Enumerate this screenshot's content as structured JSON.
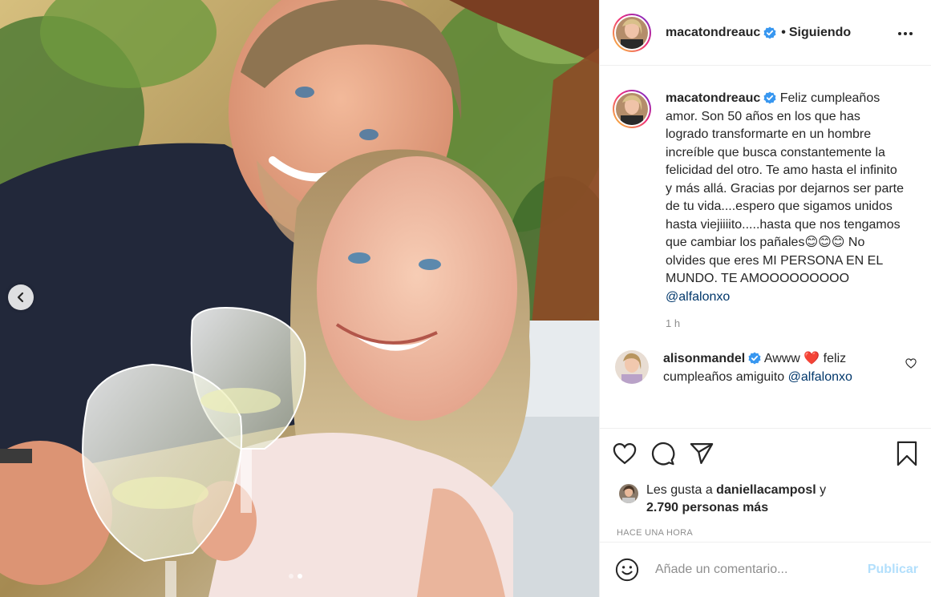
{
  "post": {
    "author": "macatondreauc",
    "following_label": "Siguiendo",
    "bullet": "•",
    "caption_text": "Feliz cumpleaños amor. Son 50 años en los que has logrado transformarte en un hombre increíble que busca constantemente la felicidad del otro. Te amo hasta el infinito y más allá. Gracias por dejarnos ser parte de tu vida....espero que sigamos unidos hasta viejiiiito.....hasta que nos tengamos que cambiar los pañales😊😊😊 No olvides que eres MI PERSONA EN EL MUNDO. TE AMOOOOOOOOO",
    "caption_mention": "@alfalonxo",
    "caption_age": "1 h",
    "carousel": {
      "slide_count": 2,
      "active_slide": 2
    }
  },
  "comments": [
    {
      "author": "alisonmandel",
      "text_before": "Awww ❤️ feliz cumpleaños amiguito ",
      "mention": "@alfalonxo"
    }
  ],
  "likes": {
    "prefix": "Les gusta a ",
    "user": "daniellacamposl",
    "joiner": " y",
    "others": "2.790 personas más"
  },
  "timestamp": "HACE UNA HORA",
  "add_comment": {
    "placeholder": "Añade un comentario...",
    "publish_label": "Publicar"
  },
  "icons": {
    "prev": "chevron-left-icon",
    "verified": "verified-badge-icon",
    "more": "more-options-icon",
    "like": "heart-icon",
    "comment": "comment-bubble-icon",
    "share": "paper-plane-icon",
    "save": "bookmark-icon",
    "emoji": "emoji-smile-icon"
  },
  "colors": {
    "verified": "#3897f0",
    "link": "#00376b",
    "muted": "#8e8e8e",
    "publish_disabled": "#b2dffc",
    "heart": "#ed4956"
  }
}
